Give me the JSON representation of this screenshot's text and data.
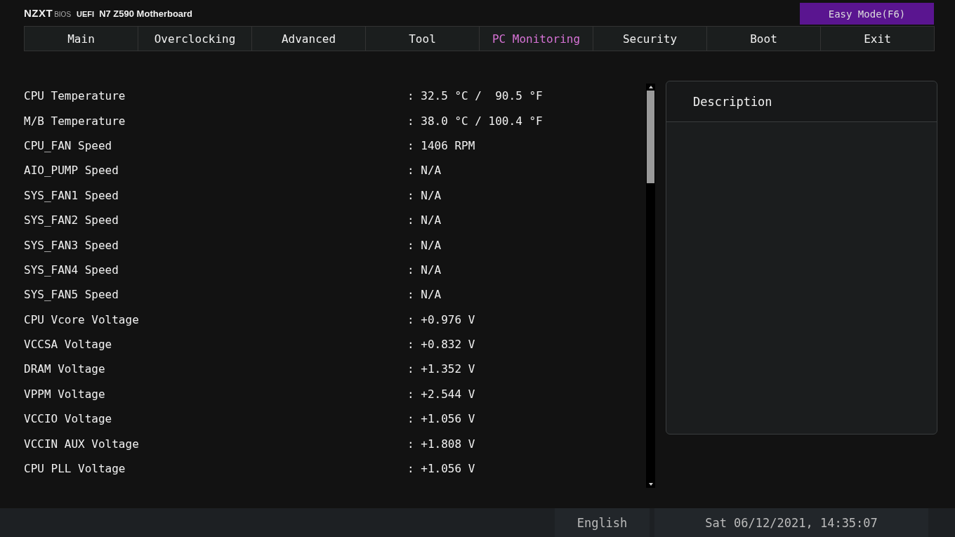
{
  "header": {
    "brand": "NZXT",
    "brand_suffix": "BIOS",
    "firmware": "UEFI",
    "board": "N7 Z590 Motherboard",
    "mode_button": "Easy Mode(F6)"
  },
  "tabs": [
    {
      "label": "Main",
      "selected": false
    },
    {
      "label": "Overclocking",
      "selected": false
    },
    {
      "label": "Advanced",
      "selected": false
    },
    {
      "label": "Tool",
      "selected": false
    },
    {
      "label": "PC Monitoring",
      "selected": true
    },
    {
      "label": "Security",
      "selected": false
    },
    {
      "label": "Boot",
      "selected": false
    },
    {
      "label": "Exit",
      "selected": false
    }
  ],
  "readings": [
    {
      "name": "CPU Temperature",
      "value": ": 32.5 °C /  90.5 °F"
    },
    {
      "name": "M/B Temperature",
      "value": ": 38.0 °C / 100.4 °F"
    },
    {
      "name": "CPU_FAN Speed",
      "value": ": 1406 RPM"
    },
    {
      "name": "AIO_PUMP Speed",
      "value": ": N/A"
    },
    {
      "name": "SYS_FAN1 Speed",
      "value": ": N/A"
    },
    {
      "name": "SYS_FAN2 Speed",
      "value": ": N/A"
    },
    {
      "name": "SYS_FAN3 Speed",
      "value": ": N/A"
    },
    {
      "name": "SYS_FAN4 Speed",
      "value": ": N/A"
    },
    {
      "name": "SYS_FAN5 Speed",
      "value": ": N/A"
    },
    {
      "name": "CPU Vcore Voltage",
      "value": ": +0.976 V"
    },
    {
      "name": "VCCSA Voltage",
      "value": ": +0.832 V"
    },
    {
      "name": "DRAM Voltage",
      "value": ": +1.352 V"
    },
    {
      "name": "VPPM Voltage",
      "value": ": +2.544 V"
    },
    {
      "name": "VCCIO Voltage",
      "value": ": +1.056 V"
    },
    {
      "name": "VCCIN AUX Voltage",
      "value": ": +1.808 V"
    },
    {
      "name": "CPU PLL Voltage",
      "value": ": +1.056 V"
    }
  ],
  "description": {
    "title": "Description"
  },
  "status_bar": {
    "language": "English",
    "datetime": "Sat 06/12/2021, 14:35:07"
  }
}
